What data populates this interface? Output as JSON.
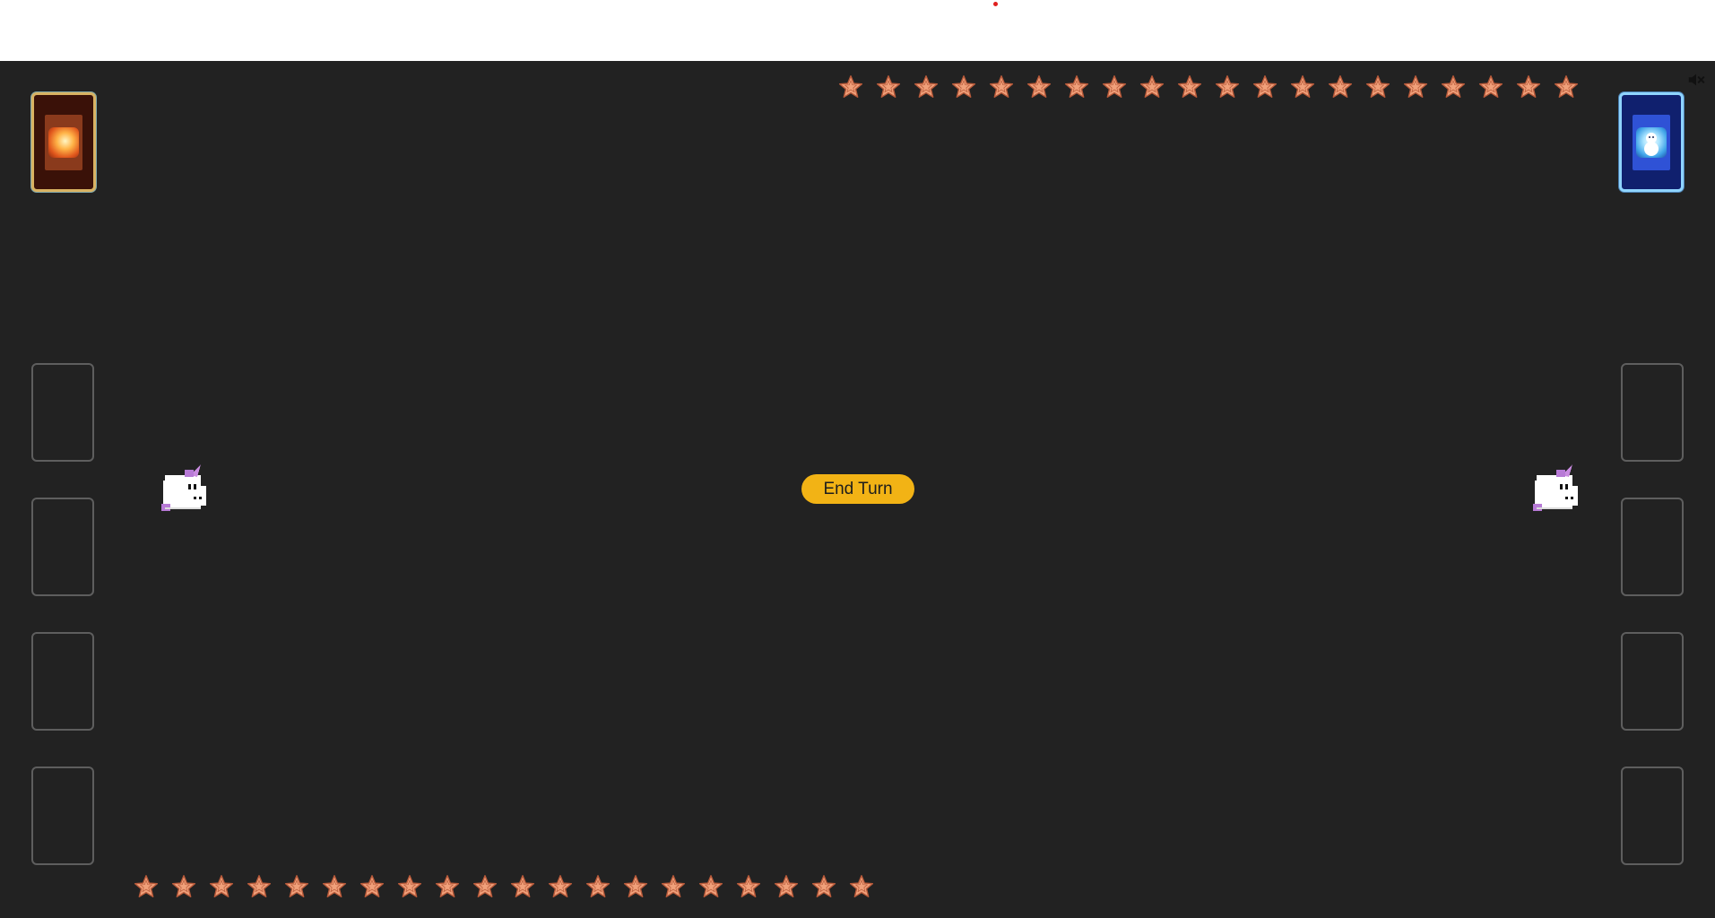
{
  "game": {
    "end_turn_label": "End Turn",
    "muted": true
  },
  "icons": {
    "mute": "speaker-muted-icon",
    "star": "star-icon",
    "unicorn": "unicorn-icon"
  },
  "player_deck": {
    "theme": "fire",
    "art_icon": "sun-burst-icon"
  },
  "opponent_deck": {
    "theme": "ice",
    "art_icon": "snowman-icon"
  },
  "opponent_stars": 20,
  "player_stars": 20,
  "player_slots": 4,
  "opponent_slots": 4,
  "colors": {
    "board": "#222222",
    "star_fill": "#f0a07a",
    "star_outline": "#b85a3a",
    "end_turn": "#f2b315",
    "player_deck_border": "#d9b262",
    "opponent_deck_border": "#8fd4ff"
  }
}
